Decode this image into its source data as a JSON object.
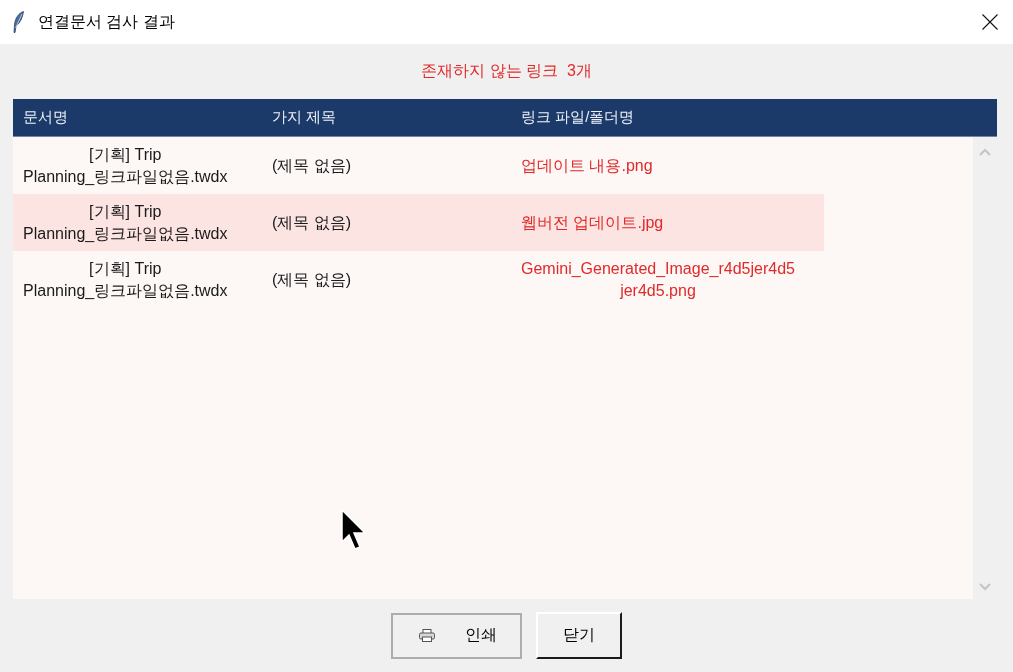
{
  "window": {
    "title": "연결문서 검사 결과"
  },
  "summary": "존재하지 않는 링크  3개",
  "table": {
    "columns": [
      "문서명",
      "가지 제목",
      "링크 파일/폴더명"
    ],
    "rows": [
      {
        "document": "[기획] Trip\nPlanning_링크파일없음.twdx",
        "branch_title": "(제목 없음)",
        "link": "업데이트 내용.png",
        "selected": false
      },
      {
        "document": "[기획] Trip\nPlanning_링크파일없음.twdx",
        "branch_title": "(제목 없음)",
        "link": "웹버전 업데이트.jpg",
        "selected": true
      },
      {
        "document": "[기획] Trip\nPlanning_링크파일없음.twdx",
        "branch_title": "(제목 없음)",
        "link": "Gemini_Generated_Image_r4d5jer4d5\njer4d5.png",
        "selected": false
      }
    ]
  },
  "buttons": [
    {
      "label": "인쇄",
      "kind": "icon"
    },
    {
      "label": "닫기",
      "kind": "plain"
    }
  ]
}
